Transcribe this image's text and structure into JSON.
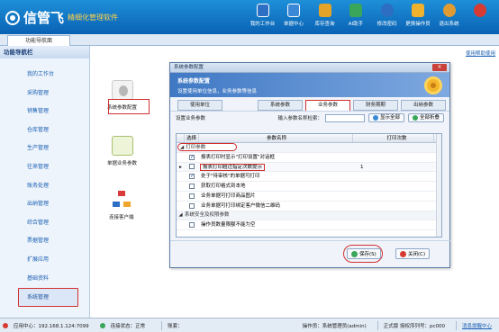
{
  "header": {
    "logo_text": "信管飞",
    "tagline": "精细化管理软件",
    "nav": [
      {
        "label": "我的工作台",
        "icon": "monitor-icon",
        "color": "#2d6fc4"
      },
      {
        "label": "单据中心",
        "icon": "documents-icon",
        "color": "#3b88d6"
      },
      {
        "label": "库存查询",
        "icon": "inventory-icon",
        "color": "#e5a428"
      },
      {
        "label": "AI助手",
        "icon": "chart-icon",
        "color": "#3aa659"
      },
      {
        "label": "修改密码",
        "icon": "info-icon",
        "color": "#2e6ec2"
      },
      {
        "label": "更换操作员",
        "icon": "lock-icon",
        "color": "#f0b12c"
      },
      {
        "label": "退出系统",
        "icon": "user-icon",
        "color": "#e19b33"
      },
      {
        "label": "",
        "icon": "close-icon",
        "color": "#d63b33"
      }
    ]
  },
  "tabs": [
    {
      "label": "功能导航面"
    }
  ],
  "sidebar": {
    "title": "功能导航栏",
    "items": [
      {
        "label": "我的工作台"
      },
      {
        "label": "采购管理"
      },
      {
        "label": "销售管理"
      },
      {
        "label": "仓库管理"
      },
      {
        "label": "生产管理"
      },
      {
        "label": "往来管理"
      },
      {
        "label": "账务处理"
      },
      {
        "label": "出纳管理"
      },
      {
        "label": "综合管理"
      },
      {
        "label": "票据管理"
      },
      {
        "label": "扩展应用"
      },
      {
        "label": "基础资料"
      },
      {
        "label": "系统管理"
      }
    ]
  },
  "main": {
    "help_link": "使用帮助使用",
    "tiles": [
      {
        "label": "系统参数配置",
        "icon": "settings-icon"
      },
      {
        "label": "单据业务参数",
        "icon": "business-param-icon"
      },
      {
        "label": "连接客户端",
        "icon": "network-icon"
      }
    ]
  },
  "dialog": {
    "title": "系统参数配置",
    "close_label": "×",
    "banner_title": "系统参数配置",
    "banner_subtitle": "设置使用单位信息，业务参数等信息",
    "tabs": [
      {
        "label": "使用单位"
      },
      {
        "label": "系统参数"
      },
      {
        "label": "业务参数"
      },
      {
        "label": "财务期期"
      },
      {
        "label": "出纳参数"
      }
    ],
    "toolbar": {
      "left_label": "设置业务参数",
      "search_label": "输入参数名称检索：",
      "search_value": "",
      "show_all": "显示全部",
      "collapse_all": "全部折叠"
    },
    "grid": {
      "headers": [
        "选择",
        "参数名称",
        "打印次数"
      ],
      "rows": [
        {
          "type": "group",
          "label": "打印参数"
        },
        {
          "checked": true,
          "name": "报表打印时显示\"打印设置\"对话框",
          "value": ""
        },
        {
          "checked": false,
          "name": "报表打印超过指定次数提示",
          "value": "1",
          "selected": true
        },
        {
          "checked": true,
          "name": "处于\"待审核\"的单据可打印",
          "value": ""
        },
        {
          "checked": false,
          "name": "获取打印格式到本地",
          "value": ""
        },
        {
          "checked": false,
          "name": "业务单据可打印商品图片",
          "value": ""
        },
        {
          "checked": false,
          "name": "业务单据可打印绑定客户微信二维码",
          "value": ""
        },
        {
          "type": "group",
          "label": "系统安全及权限参数"
        },
        {
          "checked": false,
          "name": "操作员数量限额不能为空",
          "value": ""
        }
      ]
    },
    "footer": {
      "save": "保存(S)",
      "close": "关闭(C)"
    }
  },
  "status": {
    "app_center": "应用中心：192.168.1.124:7099",
    "connect": "连接状态：正常",
    "account": "账套：",
    "operator": "操作员：系统管理员(admin)",
    "license": "正式版 授权序列号：pc000",
    "message": "消息提醒中心"
  },
  "colors": {
    "header_top": "#1e8fd8",
    "header_bottom": "#0a62b4",
    "annotation": "#d03030",
    "link": "#1a5fb4"
  }
}
